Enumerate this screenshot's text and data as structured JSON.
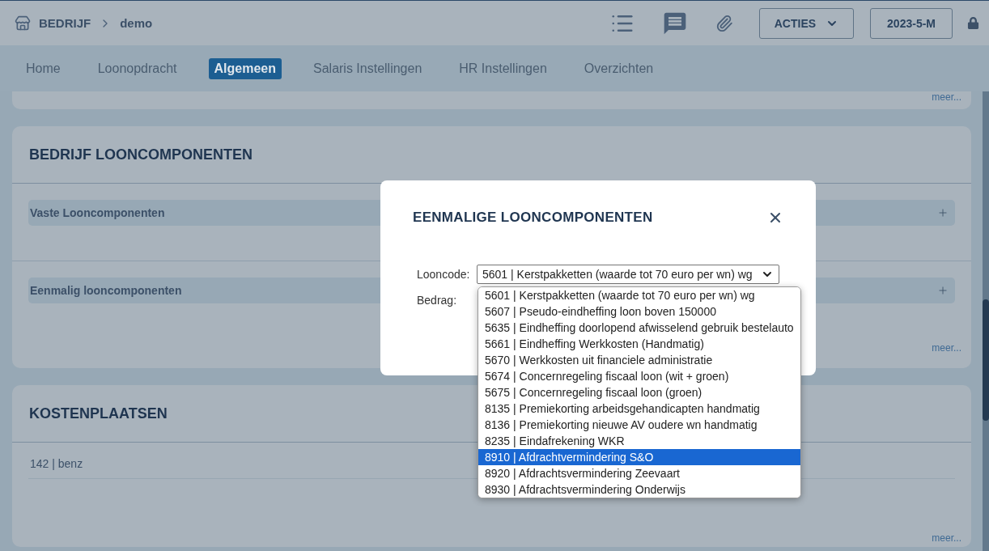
{
  "header": {
    "breadcrumb_root": "BEDRIJF",
    "breadcrumb_current": "demo",
    "actions_button": "ACTIES",
    "period_button": "2023-5-M"
  },
  "tabs": [
    {
      "label": "Home",
      "selected": false
    },
    {
      "label": "Loonopdracht",
      "selected": false
    },
    {
      "label": "Algemeen",
      "selected": true
    },
    {
      "label": "Salaris Instellingen",
      "selected": false
    },
    {
      "label": "HR Instellingen",
      "selected": false
    },
    {
      "label": "Overzichten",
      "selected": false
    }
  ],
  "cards": [
    {
      "kind": "partial",
      "more": "meer..."
    },
    {
      "kind": "sections",
      "title": "BEDRIJF LOONCOMPONENTEN",
      "sections": [
        {
          "label": "Vaste Looncomponenten",
          "expanded": false
        },
        {
          "label": "Eenmalig looncomponenten",
          "expanded": false
        }
      ],
      "more": "meer..."
    },
    {
      "kind": "list",
      "title": "KOSTENPLAATSEN",
      "rows": [
        "142 | benz"
      ],
      "more": "meer..."
    }
  ],
  "modal": {
    "title": "EENMALIGE LOONCOMPONENTEN",
    "looncode_label": "Looncode:",
    "looncode_value": "5601 | Kerstpakketten (waarde tot 70 euro per wn) wg",
    "bedrag_label": "Bedrag:",
    "options": [
      {
        "label": "5601 | Kerstpakketten (waarde tot 70 euro per wn) wg",
        "selected": false
      },
      {
        "label": "5607 | Pseudo-eindheffing loon boven 150000",
        "selected": false
      },
      {
        "label": "5635 | Eindheffing doorlopend afwisselend gebruik bestelauto",
        "selected": false
      },
      {
        "label": "5661 | Eindheffing Werkkosten (Handmatig)",
        "selected": false
      },
      {
        "label": "5670 | Werkkosten uit financiele administratie",
        "selected": false
      },
      {
        "label": "5674 | Concernregeling fiscaal loon (wit + groen)",
        "selected": false
      },
      {
        "label": "5675 | Concernregeling fiscaal loon (groen)",
        "selected": false
      },
      {
        "label": "8135 | Premiekorting arbeidsgehandicapten handmatig",
        "selected": false
      },
      {
        "label": "8136 | Premiekorting nieuwe AV oudere wn handmatig",
        "selected": false
      },
      {
        "label": "8235 | Eindafrekening WKR",
        "selected": false
      },
      {
        "label": "8910 | Afdrachtvermindering S&O",
        "selected": true
      },
      {
        "label": "8920 | Afdrachtsvermindering Zeevaart",
        "selected": false
      },
      {
        "label": "8930 | Afdrachtsvermindering Onderwijs",
        "selected": false
      }
    ]
  }
}
